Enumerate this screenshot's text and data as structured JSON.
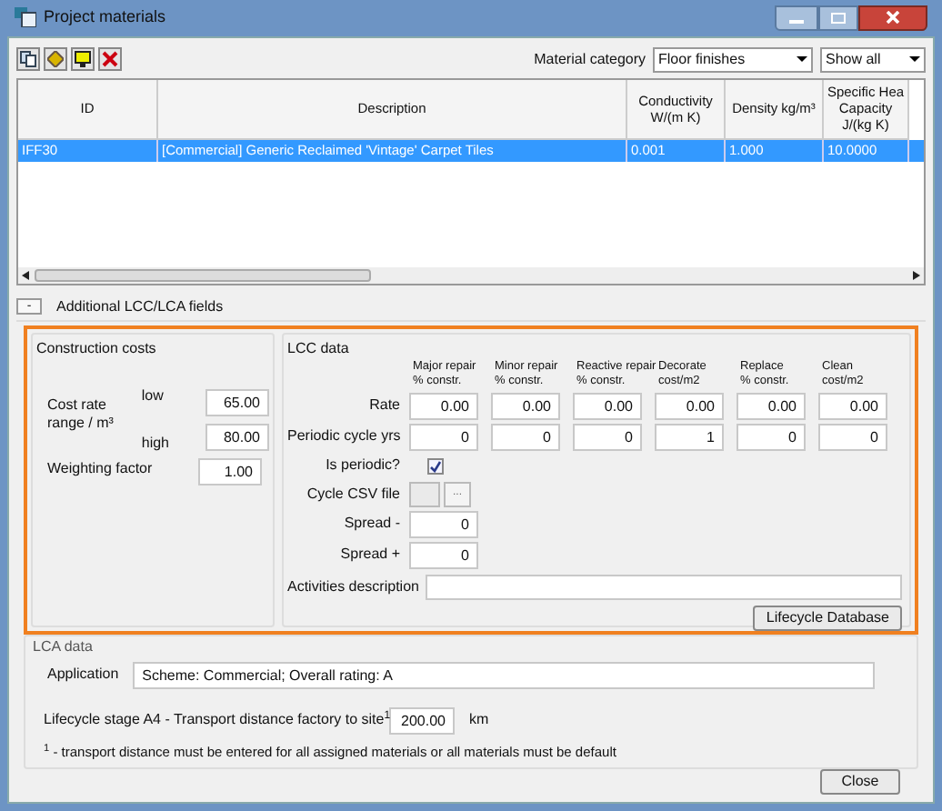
{
  "window": {
    "title": "Project materials"
  },
  "filters": {
    "label": "Material category",
    "category": "Floor finishes",
    "show": "Show all"
  },
  "table": {
    "columns": [
      "ID",
      "Description",
      "Conductivity\nW/(m K)",
      "Density kg/m³",
      "Specific Hea\nCapacity\nJ/(kg K)"
    ],
    "rows": [
      {
        "cells": [
          "IFF30",
          "[Commercial] Generic Reclaimed 'Vintage' Carpet Tiles",
          "0.001",
          "1.000",
          "10.0000"
        ],
        "selected": true
      }
    ]
  },
  "additional": {
    "toggle": "-",
    "label": "Additional LCC/LCA fields",
    "expanded": true
  },
  "construction_costs": {
    "title": "Construction costs",
    "cost_rate_label": "Cost rate range / m³",
    "low_label": "low",
    "low": "65.00",
    "high_label": "high",
    "high": "80.00",
    "weighting_label": "Weighting factor",
    "weighting": "1.00"
  },
  "lcc": {
    "title": "LCC data",
    "columns": [
      "Major repair\n% constr.",
      "Minor repair\n% constr.",
      "Reactive repair\n% constr.",
      "Decorate\ncost/m2",
      "Replace\n% constr.",
      "Clean\ncost/m2"
    ],
    "rate_label": "Rate",
    "rates": [
      "0.00",
      "0.00",
      "0.00",
      "0.00",
      "0.00",
      "0.00"
    ],
    "cycle_label": "Periodic cycle yrs",
    "cycles": [
      "0",
      "0",
      "0",
      "1",
      "0",
      "0"
    ],
    "periodic_label": "Is periodic?",
    "periodic": true,
    "csv_label": "Cycle CSV file",
    "browse": "...",
    "spread_minus_label": "Spread -",
    "spread_minus": "0",
    "spread_plus_label": "Spread +",
    "spread_plus": "0",
    "activities_label": "Activities description",
    "database_button": "Lifecycle Database"
  },
  "lca": {
    "title": "LCA data",
    "application_label": "Application",
    "application": "Scheme: Commercial; Overall rating: A",
    "transport_label": "Lifecycle stage A4 - Transport distance factory to site$^{1}$",
    "transport": "200.00",
    "unit": "km",
    "footnote": "$^{1}$ - transport distance must be entered for all assigned materials or all materials must be default"
  },
  "buttons": [
    "Close"
  ]
}
